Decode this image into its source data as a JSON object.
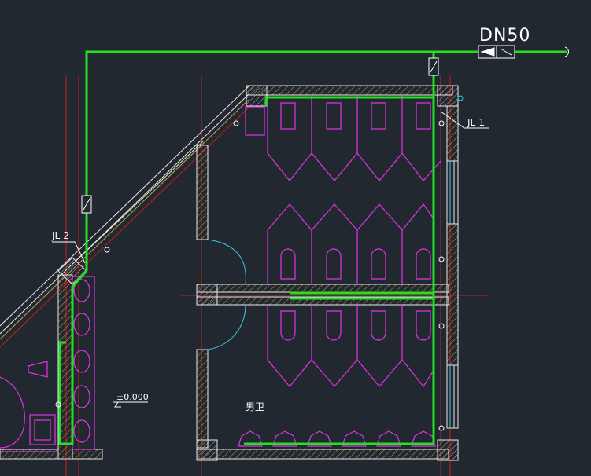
{
  "drawing": {
    "pipe_size_label": "DN50",
    "riser_1_label": "JL-1",
    "riser_2_label": "JL-2",
    "elevation_label": "±0.000",
    "room_label": "男卫"
  },
  "colors": {
    "background": "#212830",
    "pipe": "#22e022",
    "fixture": "#e632e6",
    "wall": "#e8e8e8",
    "hatch": "#c8a050",
    "axis": "#c81e1e",
    "door": "#40c8e0"
  }
}
